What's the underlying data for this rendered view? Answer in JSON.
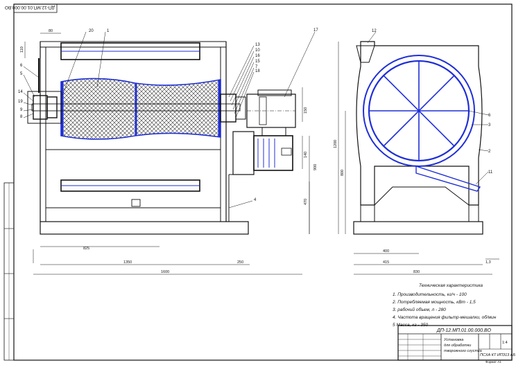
{
  "drawing": {
    "code_top_stamp": "ДП-12.МП.01.00.000.ВО",
    "positions": {
      "p20": "20",
      "p1": "1",
      "p13": "13",
      "p10": "10",
      "p16": "16",
      "p15": "15",
      "p7": "7",
      "p18": "18",
      "p17": "17",
      "p12": "12",
      "p6a": "6",
      "p5": "5",
      "p14": "14",
      "p19": "19",
      "p9": "9",
      "p8": "8",
      "p4": "4",
      "p6b": "6",
      "p3": "3",
      "p2": "2",
      "p11": "11"
    },
    "dims": {
      "d80": "80",
      "d110": "110",
      "d150": "150",
      "d140": "140",
      "d900": "900",
      "d470": "470",
      "d825": "825",
      "d1350": "1350",
      "d250": "250",
      "d1600": "1600",
      "d1200": "1200",
      "d800": "800",
      "d400": "400",
      "d415": "415",
      "d830": "830",
      "d1_3": "1,3"
    }
  },
  "specs": {
    "title": "Техническая характеристика",
    "lines": [
      "1. Производительность, кг/ч - 100",
      "2. Потребляемая мощность, кВт - 1,5",
      "3. рабочий объем, л - 280",
      "4. Частота вращения фильтр-мешалки, об/мин",
      "5 Масса, кг - 350"
    ]
  },
  "title_block": {
    "code": "ДП-12.МП.01.00.000.ВО",
    "name_line1": "Установка",
    "name_line2": "для обработки",
    "name_line3": "творожного сгустка",
    "scale": "1:4",
    "group": "ПСХА КТ ИПЗ13 АБ",
    "format": "Формат А1"
  }
}
